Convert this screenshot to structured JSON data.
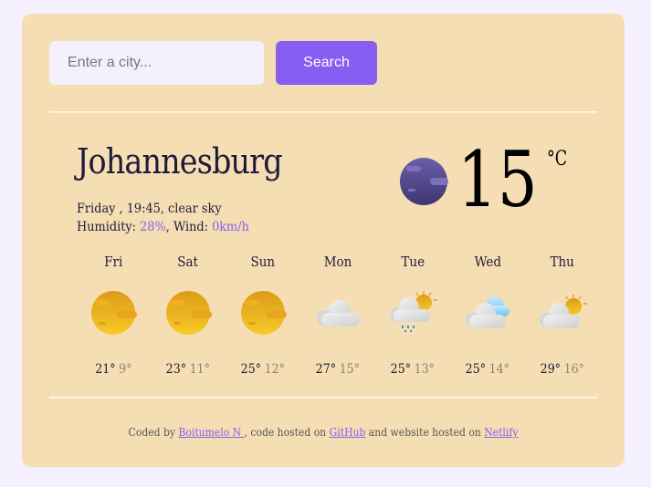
{
  "search": {
    "placeholder": "Enter a city...",
    "value": "",
    "button_label": "Search"
  },
  "current": {
    "city": "Johannesburg",
    "day": "Friday",
    "time": "19:45",
    "description": "clear sky",
    "humidity_label": "Humidity: ",
    "humidity": "28%",
    "wind_label": "Wind: ",
    "wind": "0km/h",
    "temperature": "15",
    "unit": "°C",
    "icon": "clear-sky-night-icon"
  },
  "forecast": [
    {
      "day": "Fri",
      "max": "21°",
      "min": "9°",
      "icon": "sunny-icon"
    },
    {
      "day": "Sat",
      "max": "23°",
      "min": "11°",
      "icon": "sunny-icon"
    },
    {
      "day": "Sun",
      "max": "25°",
      "min": "12°",
      "icon": "sunny-icon"
    },
    {
      "day": "Mon",
      "max": "27°",
      "min": "15°",
      "icon": "cloudy-icon"
    },
    {
      "day": "Tue",
      "max": "25°",
      "min": "13°",
      "icon": "rain-partly-sunny-icon"
    },
    {
      "day": "Wed",
      "max": "25°",
      "min": "14°",
      "icon": "broken-clouds-icon"
    },
    {
      "day": "Thu",
      "max": "29°",
      "min": "16°",
      "icon": "partly-cloudy-icon"
    }
  ],
  "footer": {
    "text1": "Coded by ",
    "author": "Boitumelo N ",
    "text2": ", code hosted on ",
    "github": "GitHub",
    "text3": " and website hosted on ",
    "netlify": "Netlify"
  },
  "colors": {
    "accent": "#885df1",
    "card": "#f5deb3",
    "page": "#f4f0fe"
  }
}
